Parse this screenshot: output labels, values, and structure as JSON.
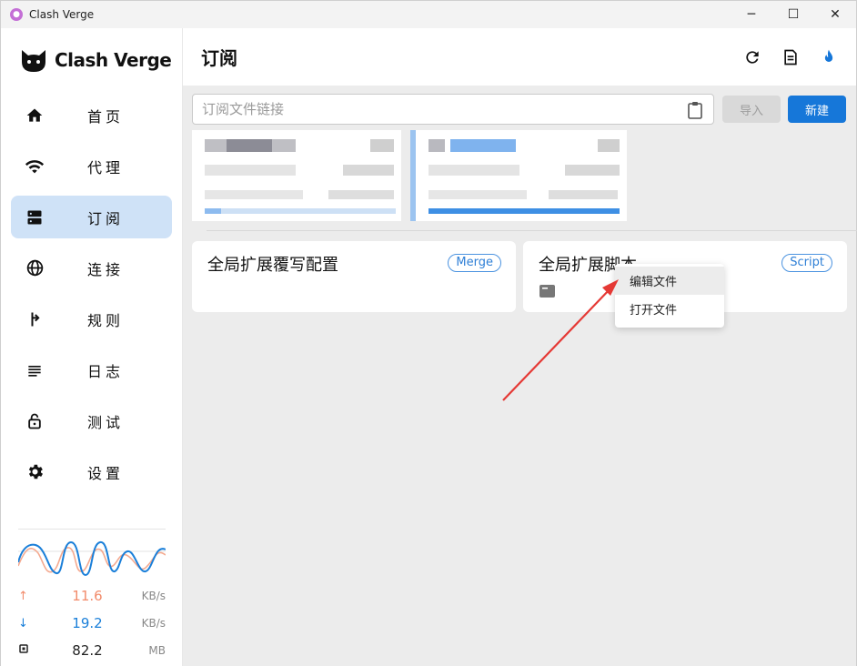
{
  "window": {
    "title": "Clash Verge",
    "controls": {
      "minimize": "─",
      "maximize": "☐",
      "close": "✕"
    }
  },
  "sidebar": {
    "logo_text": "Clash Verge",
    "items": [
      {
        "label": "首页",
        "icon": "home-icon",
        "active": false
      },
      {
        "label": "代理",
        "icon": "wifi-icon",
        "active": false
      },
      {
        "label": "订阅",
        "icon": "dns-icon",
        "active": true
      },
      {
        "label": "连接",
        "icon": "globe-icon",
        "active": false
      },
      {
        "label": "规则",
        "icon": "fork-arrow-icon",
        "active": false
      },
      {
        "label": "日志",
        "icon": "list-lines-icon",
        "active": false
      },
      {
        "label": "测试",
        "icon": "lock-open-icon",
        "active": false
      },
      {
        "label": "设置",
        "icon": "gear-icon",
        "active": false
      }
    ],
    "traffic": {
      "upload": {
        "value": "11.6",
        "unit": "KB/s",
        "color": "#f28b6b"
      },
      "download": {
        "value": "19.2",
        "unit": "KB/s",
        "color": "#1a7fd9"
      },
      "memory": {
        "value": "82.2",
        "unit": "MB"
      }
    }
  },
  "main": {
    "title": "订阅",
    "header_icons": [
      "refresh-icon",
      "document-icon",
      "fire-icon"
    ],
    "url_input": {
      "placeholder": "订阅文件链接",
      "value": ""
    },
    "import_label": "导入",
    "new_label": "新建",
    "ext_cards": [
      {
        "title": "全局扩展覆写配置",
        "badge": "Merge"
      },
      {
        "title": "全局扩展脚本",
        "badge": "Script"
      }
    ],
    "context_menu": {
      "items": [
        "编辑文件",
        "打开文件"
      ]
    }
  },
  "colors": {
    "accent": "#1677d9",
    "active_nav": "#cfe2f7",
    "arrow": "#e53935"
  }
}
